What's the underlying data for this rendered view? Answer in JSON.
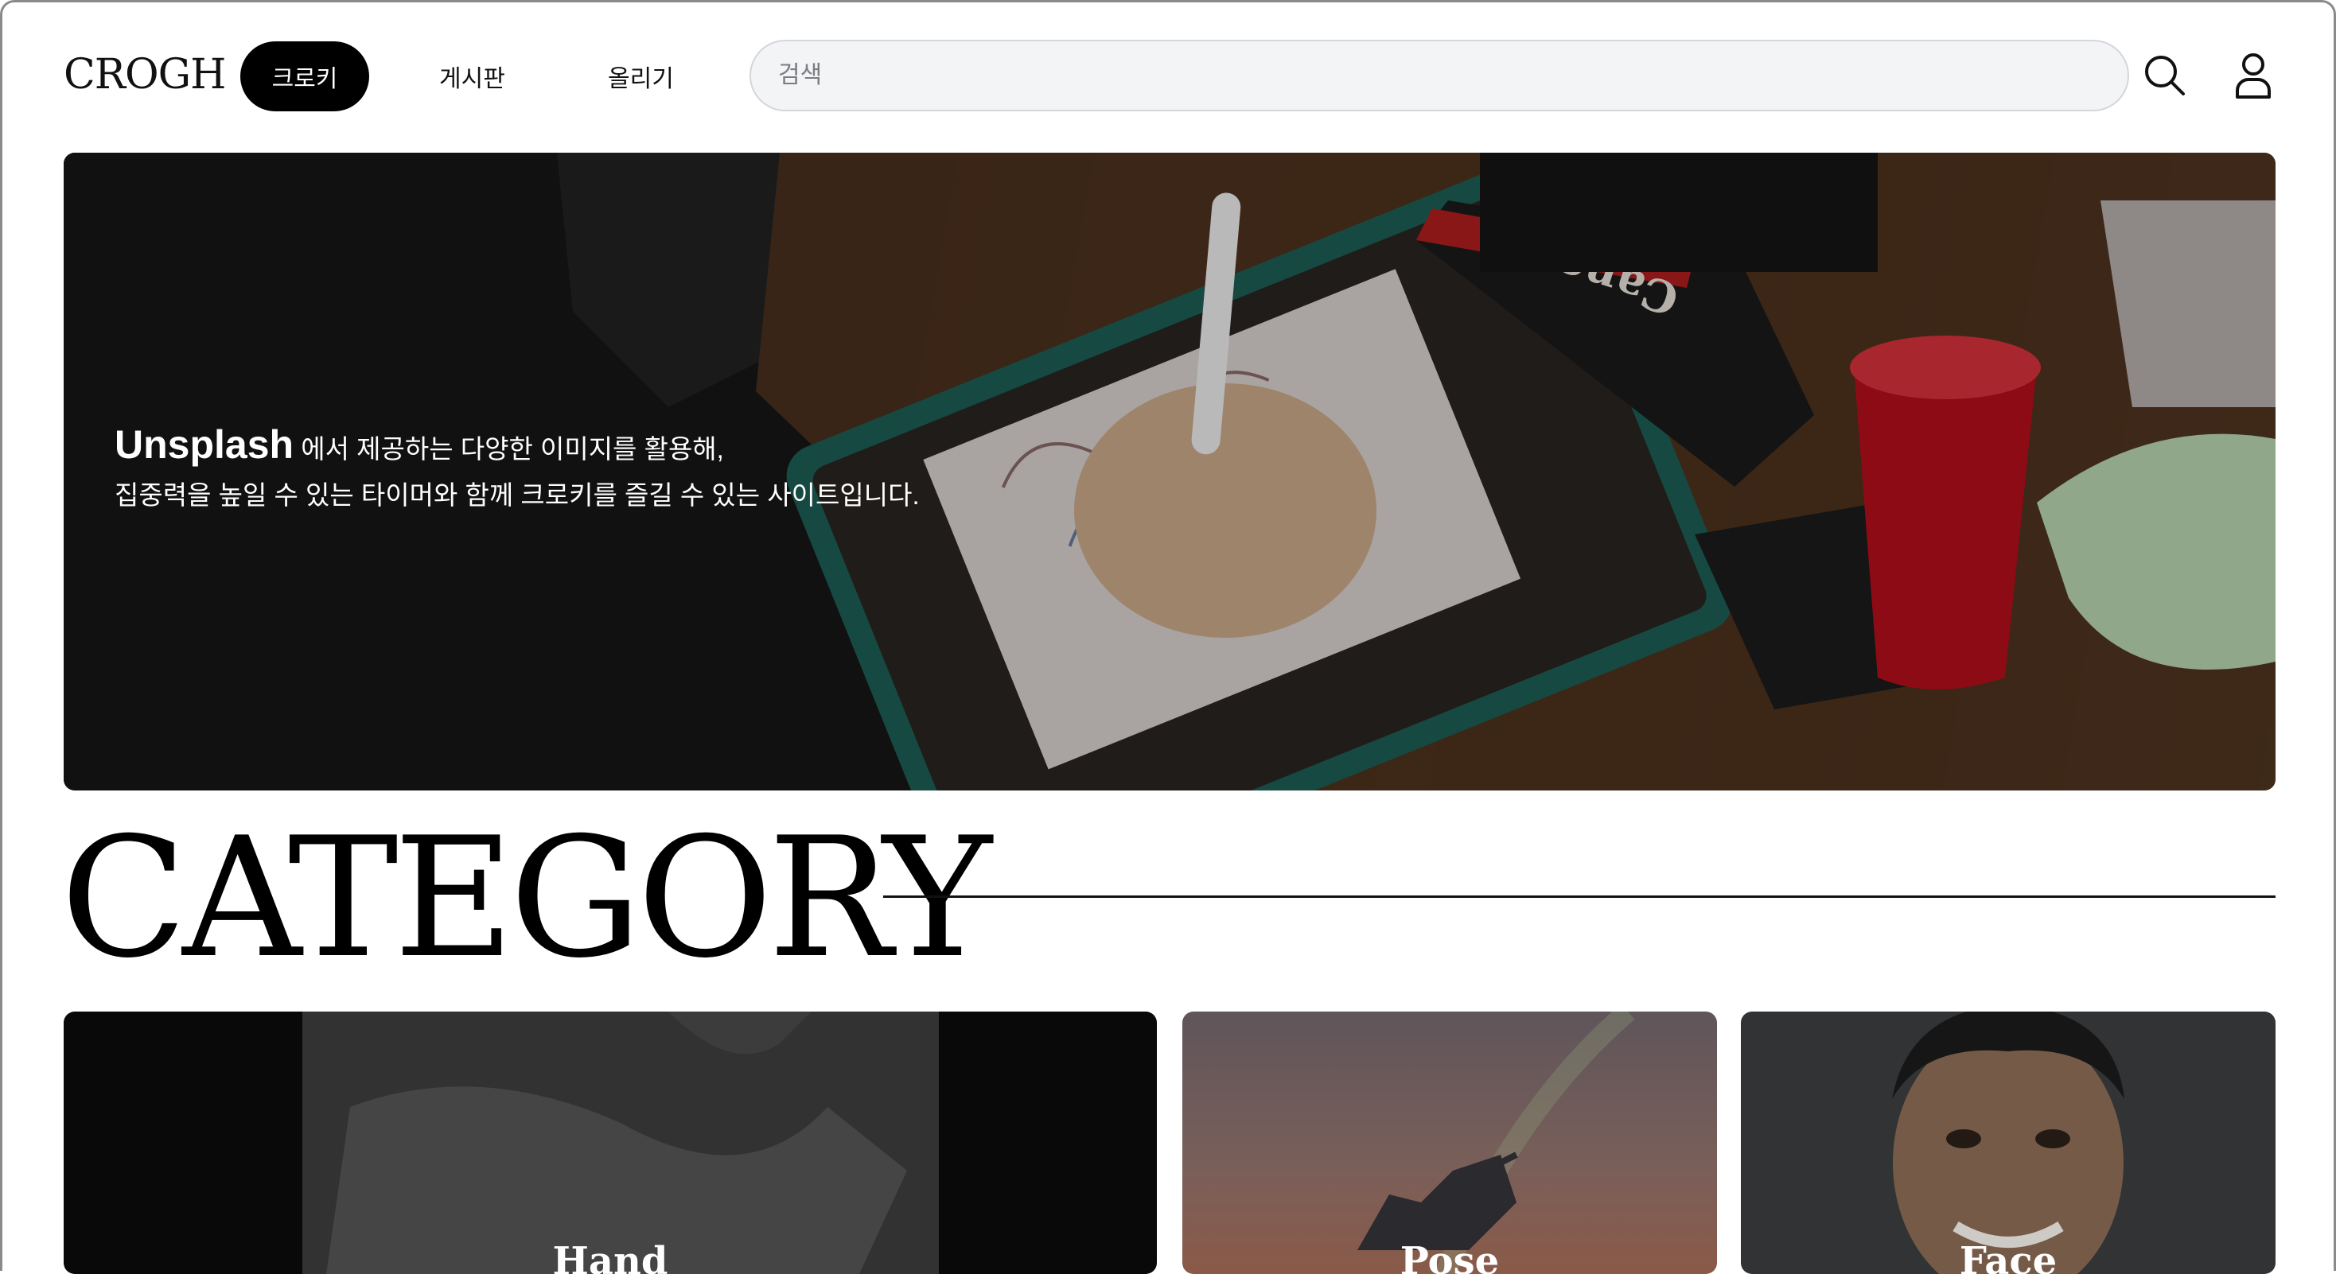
{
  "header": {
    "logo": "CROGH",
    "nav": {
      "active": "크로키",
      "board": "게시판",
      "upload": "올리기"
    },
    "search": {
      "placeholder": "검색"
    }
  },
  "hero": {
    "brand": "Unsplash",
    "line1_rest": " 에서 제공하는 다양한 이미지를 활용해,",
    "line2": "집중력을 높일 수 있는 타이머와 함께 크로키를 즐길 수 있는 사이트입니다.",
    "photo_text": "Canon"
  },
  "category": {
    "title": "CATEGORY",
    "cards": [
      {
        "label": "Hand"
      },
      {
        "label": "Pose"
      },
      {
        "label": "Face"
      }
    ]
  },
  "colors": {
    "accent": "#000000",
    "search_bg": "#f3f4f6"
  },
  "icons": {
    "search": "search-icon",
    "user": "user-icon"
  }
}
